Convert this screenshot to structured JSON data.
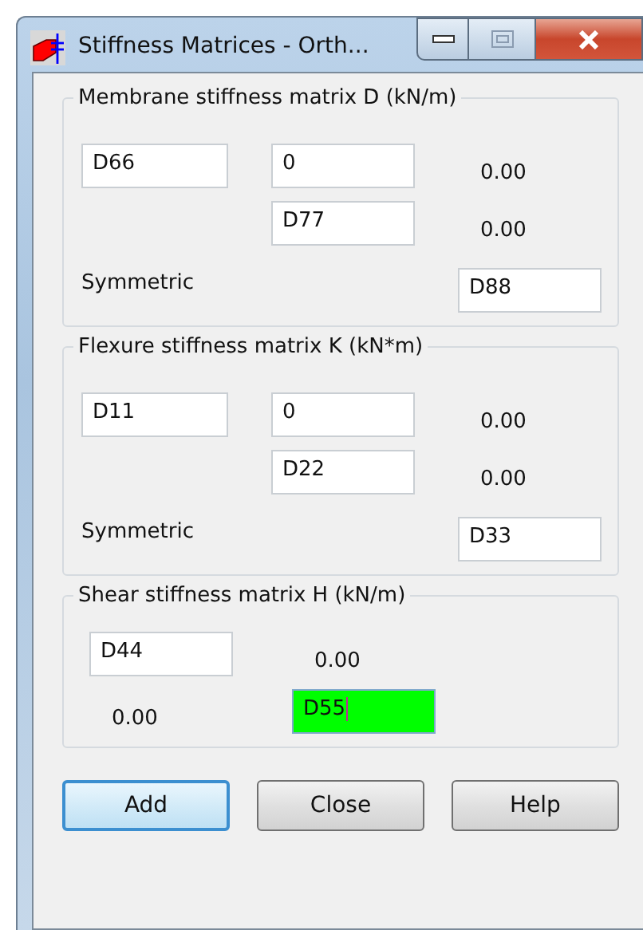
{
  "window": {
    "title": "Stiffness Matrices - Orth..."
  },
  "groups": [
    {
      "title": "Membrane stiffness matrix D (kN/m)",
      "rows": [
        [
          {
            "kind": "field",
            "value": "D66",
            "focused": false
          },
          {
            "kind": "field",
            "value": "0",
            "focused": false
          },
          {
            "kind": "text",
            "value": "0.00"
          }
        ],
        [
          {
            "kind": "blank"
          },
          {
            "kind": "field",
            "value": "D77",
            "focused": false
          },
          {
            "kind": "text",
            "value": "0.00"
          }
        ],
        [
          {
            "kind": "label",
            "value": "Symmetric"
          },
          {
            "kind": "blank"
          },
          {
            "kind": "field",
            "value": "D88",
            "focused": false
          }
        ]
      ]
    },
    {
      "title": "Flexure stiffness matrix K (kN*m)",
      "rows": [
        [
          {
            "kind": "field",
            "value": "D11",
            "focused": false
          },
          {
            "kind": "field",
            "value": "0",
            "focused": false
          },
          {
            "kind": "text",
            "value": "0.00"
          }
        ],
        [
          {
            "kind": "blank"
          },
          {
            "kind": "field",
            "value": "D22",
            "focused": false
          },
          {
            "kind": "text",
            "value": "0.00"
          }
        ],
        [
          {
            "kind": "label",
            "value": "Symmetric"
          },
          {
            "kind": "blank"
          },
          {
            "kind": "field",
            "value": "D33",
            "focused": false
          }
        ]
      ]
    },
    {
      "title": "Shear stiffness matrix H (kN/m)",
      "rows": [
        [
          {
            "kind": "field",
            "value": "D44",
            "focused": false
          },
          {
            "kind": "text",
            "value": "0.00"
          }
        ],
        [
          {
            "kind": "text",
            "value": "0.00"
          },
          {
            "kind": "field",
            "value": "D55",
            "focused": true
          }
        ]
      ]
    }
  ],
  "buttons": [
    {
      "label": "Add",
      "default": true
    },
    {
      "label": "Close",
      "default": false
    },
    {
      "label": "Help",
      "default": false
    }
  ]
}
